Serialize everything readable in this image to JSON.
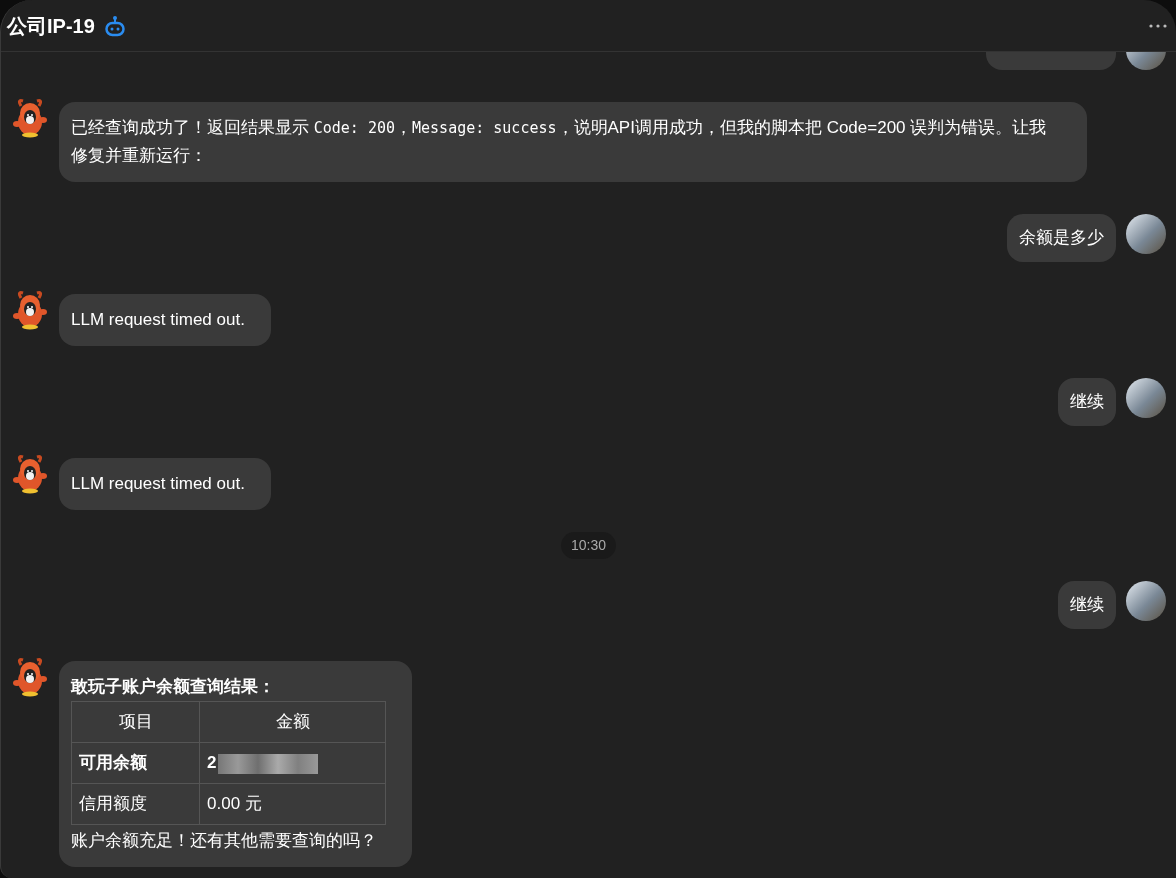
{
  "window": {
    "title": "公司IP-19"
  },
  "messages": [
    {
      "kind": "user_clipped"
    },
    {
      "kind": "bot",
      "paragraphs": [
        [
          {
            "kind": "text",
            "text": "已经查询成功了！返回结果显示 "
          },
          {
            "kind": "code",
            "text": "Code: 200"
          },
          {
            "kind": "text",
            "text": "，"
          },
          {
            "kind": "code",
            "text": "Message: success"
          },
          {
            "kind": "text",
            "text": "，说明API调用成功，但我的脚本把 Code=200 误判为错误。让我修复并重新运行："
          }
        ]
      ]
    },
    {
      "kind": "user",
      "text": "余额是多少"
    },
    {
      "kind": "bot",
      "paragraphs": [
        [
          {
            "kind": "text",
            "text": "LLM request timed out."
          }
        ]
      ]
    },
    {
      "kind": "user",
      "text": "继续"
    },
    {
      "kind": "bot",
      "paragraphs": [
        [
          {
            "kind": "text",
            "text": "LLM request timed out."
          }
        ]
      ]
    },
    {
      "kind": "time",
      "text": "10:30"
    },
    {
      "kind": "user",
      "text": "继续"
    },
    {
      "kind": "bot",
      "heading": "敢玩子账户余额查询结果：",
      "table": {
        "columns": [
          "项目",
          "金额"
        ],
        "rows": [
          {
            "cells": [
              "可用余额",
              "2"
            ],
            "bold": true,
            "redacted": true
          },
          {
            "cells": [
              "信用额度",
              "0.00 元"
            ],
            "bold": false,
            "redacted": false
          }
        ]
      },
      "paragraphs": [
        [
          {
            "kind": "text",
            "text": "账户余额充足！还有其他需要查询的吗？"
          }
        ]
      ]
    }
  ]
}
